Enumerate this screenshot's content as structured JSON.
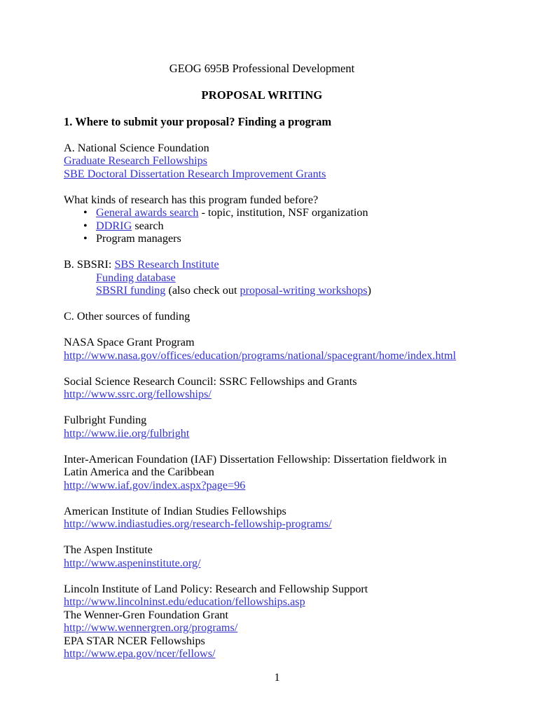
{
  "document": {
    "title": "GEOG 695B Professional Development",
    "subtitle": "PROPOSAL WRITING",
    "page_number": "1",
    "link_color": "#3333cc",
    "text_color": "#000000"
  },
  "section1": {
    "heading": "1. Where to submit your proposal? Finding a program",
    "part_a": {
      "label": "A. National Science Foundation",
      "links": [
        "Graduate Research Fellowships",
        "SBE Doctoral Dissertation Research Improvement Grants"
      ],
      "question": "What kinds of research has this program funded before?",
      "bullets": [
        {
          "marker": "•",
          "link": "General awards search",
          "text": "  - topic, institution, NSF organization"
        },
        {
          "marker": "•",
          "link": "DDRIG",
          "text": " search"
        },
        {
          "marker": "•",
          "link": "",
          "text": "Program managers"
        }
      ]
    },
    "part_b": {
      "label_prefix": "B. SBSRI: ",
      "label_link": "SBS Research Institute",
      "sub_link_1": "Funding database",
      "sub_link_2": "SBSRI funding",
      "sub_line_2_mid": " (also check out ",
      "sub_line_2_link": "proposal-writing workshops",
      "sub_line_2_end": ")"
    },
    "part_c": {
      "label": "C. Other sources of funding",
      "entries": [
        {
          "name": "NASA Space Grant Program",
          "url": "http://www.nasa.gov/offices/education/programs/national/spacegrant/home/index.html"
        },
        {
          "name": "Social Science Research Council: SSRC Fellowships and Grants",
          "url": "http://www.ssrc.org/fellowships/"
        },
        {
          "name": "Fulbright Funding",
          "url": "http://www.iie.org/fulbright"
        },
        {
          "name": "Inter-American Foundation (IAF) Dissertation Fellowship: Dissertation fieldwork in Latin America and the Caribbean",
          "url": "http://www.iaf.gov/index.aspx?page=96"
        },
        {
          "name": "American Institute of Indian Studies Fellowships",
          "url": "http://www.indiastudies.org/research-fellowship-programs/"
        },
        {
          "name": "The Aspen Institute",
          "url": "http://www.aspeninstitute.org/"
        }
      ],
      "entries_compact": [
        {
          "name": "Lincoln Institute of Land Policy: Research and Fellowship Support",
          "url": "http://www.lincolninst.edu/education/fellowships.asp"
        },
        {
          "name": "The Wenner-Gren Foundation Grant",
          "url": "http://www.wennergren.org/programs/"
        },
        {
          "name": "EPA STAR NCER Fellowships",
          "url": "http://www.epa.gov/ncer/fellows/"
        }
      ]
    }
  }
}
